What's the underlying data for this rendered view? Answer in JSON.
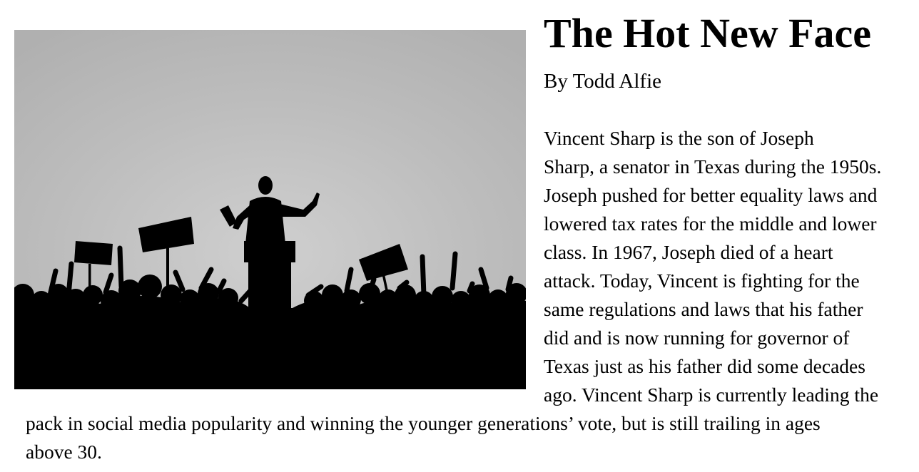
{
  "article": {
    "title": "The Hot New Face",
    "byline": "By Todd Alfie",
    "image": {
      "alt": "Silhouette of a speaker at a podium before a cheering crowd holding signs"
    },
    "body_lines": [
      "Vincent Sharp is the son of Joseph",
      "Sharp, a senator in Texas during the 1950s.",
      "Joseph pushed for better equality laws and",
      "lowered tax rates for the middle and lower",
      "class. In 1967, Joseph died of a heart",
      "attack. Today, Vincent is fighting for the",
      "same regulations and laws that his father",
      "did and is now running for governor of",
      "Texas just as his father did some decades",
      "ago. Vincent Sharp is currently leading the",
      "pack in social media popularity and winning the younger generations’ vote, but is still trailing in ages",
      "above 30."
    ]
  }
}
